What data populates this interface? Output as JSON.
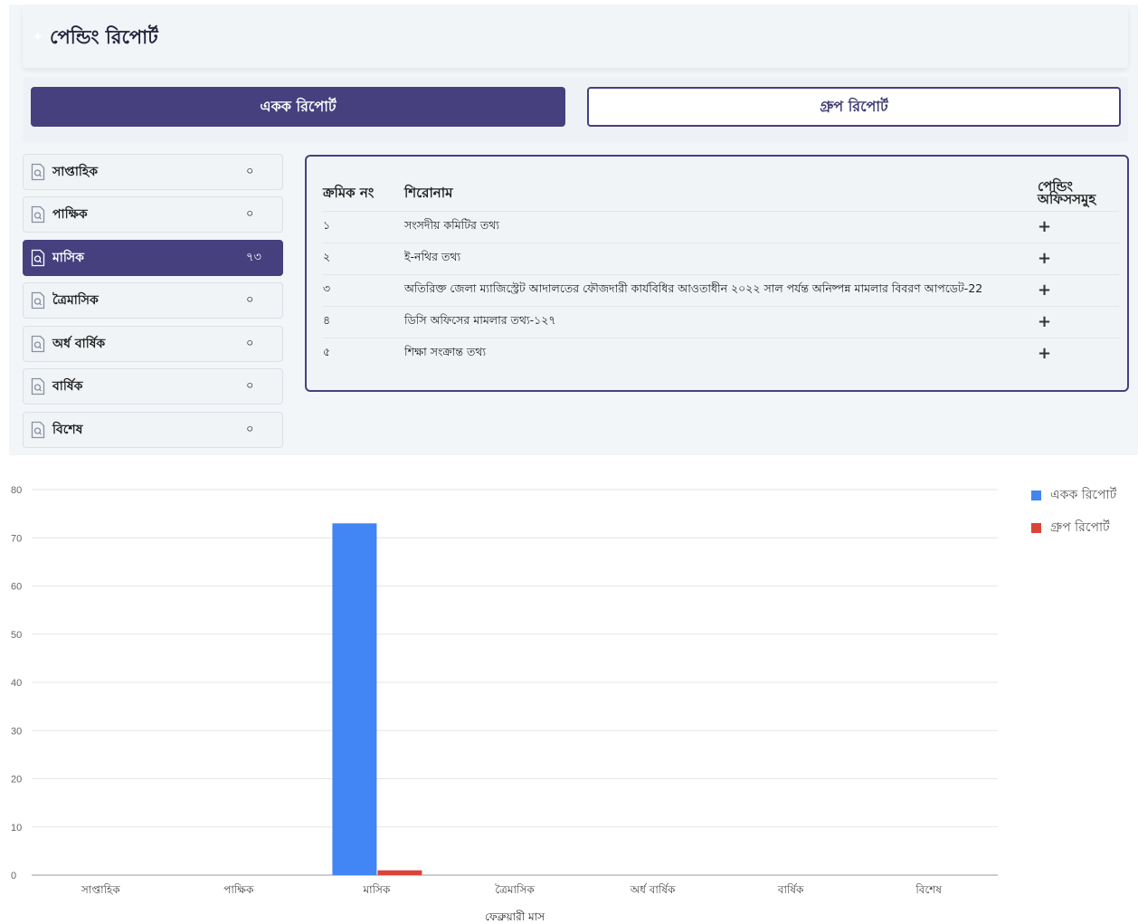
{
  "page_title": "পেন্ডিং রিপোর্ট",
  "tabs": {
    "single": "একক রিপোর্ট",
    "group": "গ্রুপ রিপোর্ট"
  },
  "sidebar": {
    "items": [
      {
        "label": "সাপ্তাহিক",
        "count": "০"
      },
      {
        "label": "পাক্ষিক",
        "count": "০"
      },
      {
        "label": "মাসিক",
        "count": "৭৩"
      },
      {
        "label": "ত্রৈমাসিক",
        "count": "০"
      },
      {
        "label": "অর্ধ বার্ষিক",
        "count": "০"
      },
      {
        "label": "বার্ষিক",
        "count": "০"
      },
      {
        "label": "বিশেষ",
        "count": "০"
      }
    ],
    "active_index": 2
  },
  "table": {
    "headers": {
      "serial": "ক্রমিক নং",
      "title": "শিরোনাম",
      "offices": "পেন্ডিং অফিসসমুহ"
    },
    "rows": [
      {
        "serial": "১",
        "title": "সংসদীয় কমিটির তথ্য",
        "action": "+"
      },
      {
        "serial": "২",
        "title": "ই-নথির তথ্য",
        "action": "+"
      },
      {
        "serial": "৩",
        "title": "অতিরিক্ত জেলা ম্যাজিস্ট্রেট আদালতের ফৌজদারী কার্যবিধির আওতাধীন ২০২২ সাল পর্যন্ত অনিষ্পন্ন মামলার বিবরণ আপডেট-22",
        "action": "+"
      },
      {
        "serial": "৪",
        "title": "ডিসি অফিসের মামলার তথ্য-১২৭",
        "action": "+"
      },
      {
        "serial": "৫",
        "title": "শিক্ষা সংক্রান্ত তথ্য",
        "action": "+"
      }
    ]
  },
  "colors": {
    "primary": "#46407f",
    "series_single": "#4285f4",
    "series_group": "#db4437"
  },
  "chart_data": {
    "type": "bar",
    "categories": [
      "সাপ্তাহিক",
      "পাক্ষিক",
      "মাসিক",
      "ত্রৈমাসিক",
      "অর্ধ বার্ষিক",
      "বার্ষিক",
      "বিশেষ"
    ],
    "series": [
      {
        "name": "একক রিপোর্ট",
        "values": [
          0,
          0,
          73,
          0,
          0,
          0,
          0
        ],
        "color": "#4285f4"
      },
      {
        "name": "গ্রুপ রিপোর্ট",
        "values": [
          0,
          0,
          1,
          0,
          0,
          0,
          0
        ],
        "color": "#db4437"
      }
    ],
    "xlabel": "ফেব্রুয়ারী মাস",
    "ylabel": "",
    "ylim": [
      0,
      80
    ],
    "yticks": [
      0,
      10,
      20,
      30,
      40,
      50,
      60,
      70,
      80
    ],
    "grid": true,
    "legend": "top-right"
  }
}
